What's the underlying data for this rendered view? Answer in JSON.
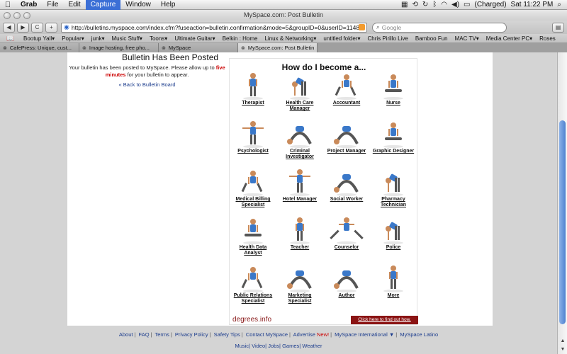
{
  "menubar": {
    "app": "Grab",
    "items": [
      "File",
      "Edit",
      "Capture",
      "Window",
      "Help"
    ],
    "active": "Capture",
    "battery": "(Charged)",
    "clock": "Sat 11:22 PM"
  },
  "window": {
    "title": "MySpace.com: Post Bulletin"
  },
  "toolbar": {
    "url": "http://bulletins.myspace.com/index.cfm?fuseaction=bulletin.confirmation&mode=5&groupID=0&userID=1148028",
    "search_placeholder": "Google"
  },
  "bookmarks": [
    "Bootup Yall▾",
    "Popular▾",
    "junk▾",
    "Music Stuff▾",
    "Toons▾",
    "Ultimate Guitar▾",
    "Belkin : Home",
    "Linux & Networking▾",
    "untitled folder▾",
    "Chris Pirillo Live",
    "Bamboo Fun",
    "MAC TV▾",
    "Media Center PC▾",
    "Roses"
  ],
  "tabs": [
    {
      "label": "CafePress: Unique, cust...",
      "active": false
    },
    {
      "label": "Image hosting, free pho...",
      "active": false
    },
    {
      "label": "MySpace",
      "active": false
    },
    {
      "label": "MySpace.com: Post Bulletin",
      "active": true
    }
  ],
  "bulletin": {
    "title": "Bulletin Has Been Posted",
    "msg_before": "Your bulletin has been posted to MySpace. Please allow up to",
    "msg_highlight": "five minutes",
    "msg_after": "for your bulletin to appear.",
    "back_link": "« Back to Bulletin Board"
  },
  "ad": {
    "title": "How do I become a...",
    "brand": "degrees.info",
    "cta": "Click here to find out how.",
    "careers": [
      {
        "label": "Therapist",
        "pose": "stand"
      },
      {
        "label": "Health Care Manager",
        "pose": "bend"
      },
      {
        "label": "Accountant",
        "pose": "lunge"
      },
      {
        "label": "Nurse",
        "pose": "sit"
      },
      {
        "label": "Psychologist",
        "pose": "tpose"
      },
      {
        "label": "Criminal Investigator",
        "pose": "arch"
      },
      {
        "label": "Project Manager",
        "pose": "arch"
      },
      {
        "label": "Graphic Designer",
        "pose": "sit"
      },
      {
        "label": "Medical Billing Specialist",
        "pose": "lunge"
      },
      {
        "label": "Hotel Manager",
        "pose": "tpose"
      },
      {
        "label": "Social Worker",
        "pose": "arch"
      },
      {
        "label": "Pharmacy Technician",
        "pose": "bend"
      },
      {
        "label": "Health Data Analyst",
        "pose": "sit"
      },
      {
        "label": "Teacher",
        "pose": "stand"
      },
      {
        "label": "Counselor",
        "pose": "split"
      },
      {
        "label": "Police",
        "pose": "bend"
      },
      {
        "label": "Public Relations Specialist",
        "pose": "lunge"
      },
      {
        "label": "Marketing Specialist",
        "pose": "arch"
      },
      {
        "label": "Author",
        "pose": "arch"
      },
      {
        "label": "More",
        "pose": "stand"
      }
    ]
  },
  "footer": {
    "links": [
      "About",
      "FAQ",
      "Terms",
      "Privacy Policy",
      "Safety Tips",
      "Contact MySpace",
      "Advertise",
      "MySpace International ▼",
      "MySpace Latino"
    ],
    "new_label": "New!",
    "links2": [
      "Music",
      "Video",
      "Jobs",
      "Games",
      "Weather"
    ]
  }
}
